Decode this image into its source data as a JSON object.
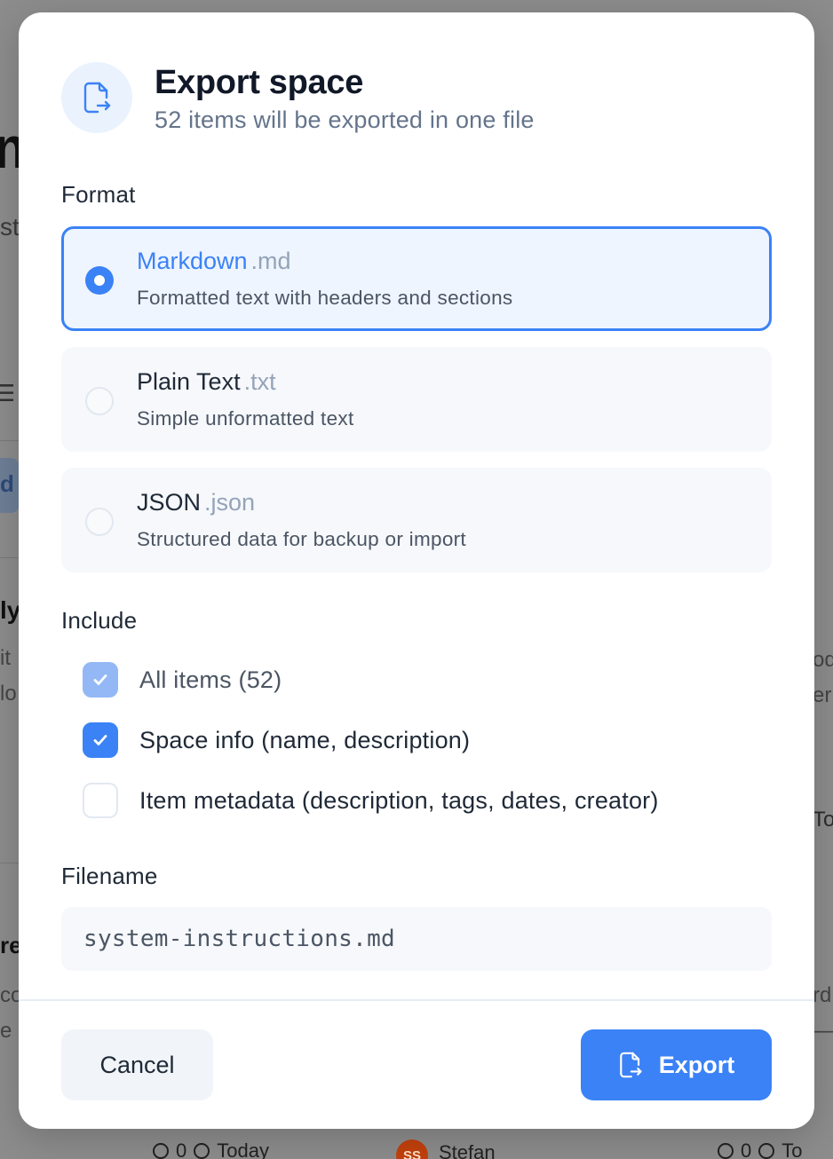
{
  "background": {
    "title_fragment": "m",
    "subtitle_fragment": "st",
    "menu_glyph": "☰",
    "pill_fragment": "d",
    "heading_fragment_1": "ly",
    "text_fragment_1": "it",
    "text_fragment_2": "lo",
    "heading_fragment_2": "re",
    "text_fragment_3": "co",
    "text_fragment_4": "e c",
    "right_fragment_1": "od",
    "right_fragment_2": "er",
    "right_fragment_3": "To",
    "right_fragment_4": "rd",
    "right_fragment_5": "—",
    "footer_left": {
      "count": "0",
      "date": "Today"
    },
    "footer_right": {
      "avatar_initials": "SS",
      "author": "Stefan",
      "count": "0",
      "date": "To"
    }
  },
  "modal": {
    "title": "Export space",
    "subtitle": "52 items will be exported in one file",
    "header_icon": "file-export-icon",
    "format_label": "Format",
    "formats": [
      {
        "name": "Markdown",
        "ext": ".md",
        "description": "Formatted text with headers and sections",
        "selected": true
      },
      {
        "name": "Plain Text",
        "ext": ".txt",
        "description": "Simple unformatted text",
        "selected": false
      },
      {
        "name": "JSON",
        "ext": ".json",
        "description": "Structured data for backup or import",
        "selected": false
      }
    ],
    "include_label": "Include",
    "include_options": [
      {
        "label": "All items (52)",
        "checked": true,
        "disabled": true
      },
      {
        "label": "Space info (name, description)",
        "checked": true,
        "disabled": false
      },
      {
        "label": "Item metadata (description, tags, dates, creator)",
        "checked": false,
        "disabled": false
      }
    ],
    "filename_label": "Filename",
    "filename_value": "system-instructions.md",
    "cancel_label": "Cancel",
    "export_label": "Export"
  },
  "colors": {
    "accent": "#3b82f6",
    "accent_disabled": "#93b8f5",
    "selected_bg": "#eef5ff",
    "option_bg": "#f6f8fb"
  }
}
